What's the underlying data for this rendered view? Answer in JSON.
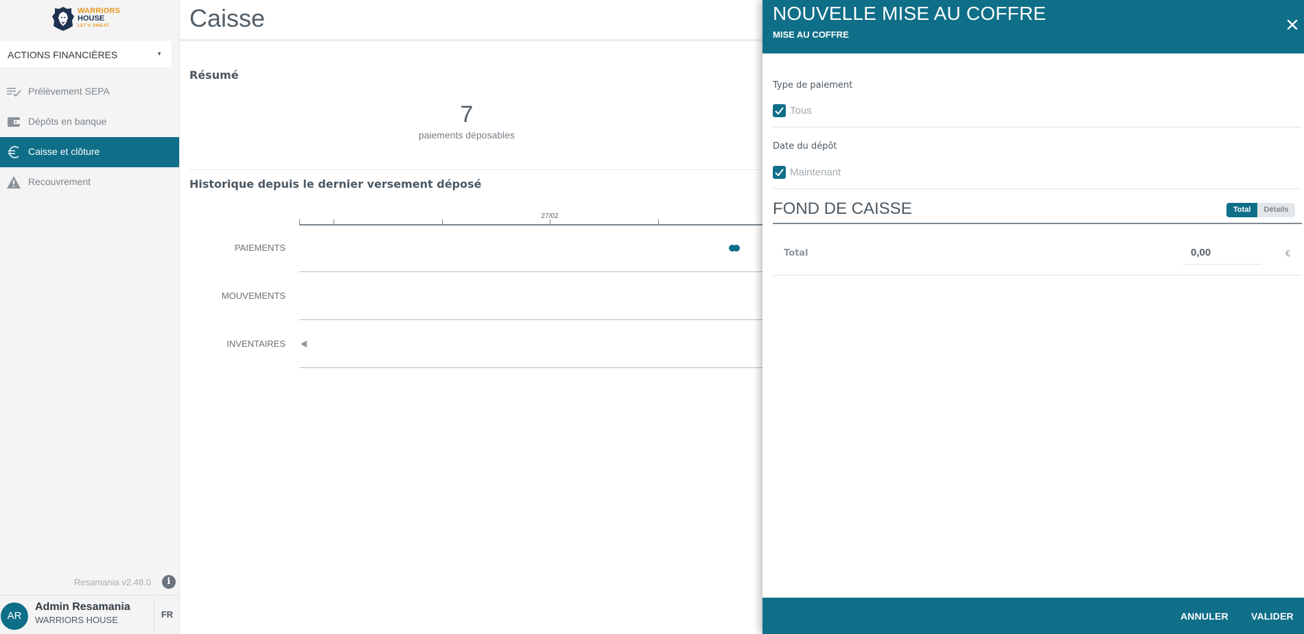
{
  "brand": {
    "logo_line1": "WARRIORS",
    "logo_line2": "HOUSE",
    "logo_tagline": "LET'S SWEAT."
  },
  "sidebar": {
    "selector_label": "ACTIONS FINANCIÈRES",
    "items": [
      {
        "label": "Prélèvement SEPA",
        "icon": "list-check-icon",
        "active": false
      },
      {
        "label": "Dépôts en banque",
        "icon": "wallet-icon",
        "active": false
      },
      {
        "label": "Caisse et clôture",
        "icon": "euro-icon",
        "active": true
      },
      {
        "label": "Recouvrement",
        "icon": "warning-icon",
        "active": false
      }
    ],
    "version": "Resamania v2.48.0"
  },
  "user": {
    "initials": "AR",
    "name": "Admin Resamania",
    "organization": "WARRIORS HOUSE",
    "language": "FR"
  },
  "main": {
    "title": "Caisse",
    "summary_title": "Résumé",
    "summary_count": "7",
    "summary_count_label": "paiements déposables",
    "history_title": "Historique depuis le dernier versement déposé",
    "timeline": {
      "tick_label": "27/02",
      "rows": [
        "PAIEMENTS",
        "MOUVEMENTS",
        "INVENTAIRES"
      ]
    }
  },
  "panel": {
    "title": "NOUVELLE MISE AU COFFRE",
    "subtitle": "MISE AU COFFRE",
    "payment_type_label": "Type de paiement",
    "payment_type_option": "Tous",
    "deposit_date_label": "Date du dépôt",
    "deposit_date_option": "Maintenant",
    "fond_title": "FOND DE CAISSE",
    "toggle_total": "Total",
    "toggle_details": "Détails",
    "total_label": "Total",
    "total_value": "0,00",
    "currency": "€",
    "cancel_label": "ANNULER",
    "validate_label": "VALIDER"
  },
  "colors": {
    "accent": "#0f6e88",
    "sidebar_bg": "#f4f4f4"
  }
}
